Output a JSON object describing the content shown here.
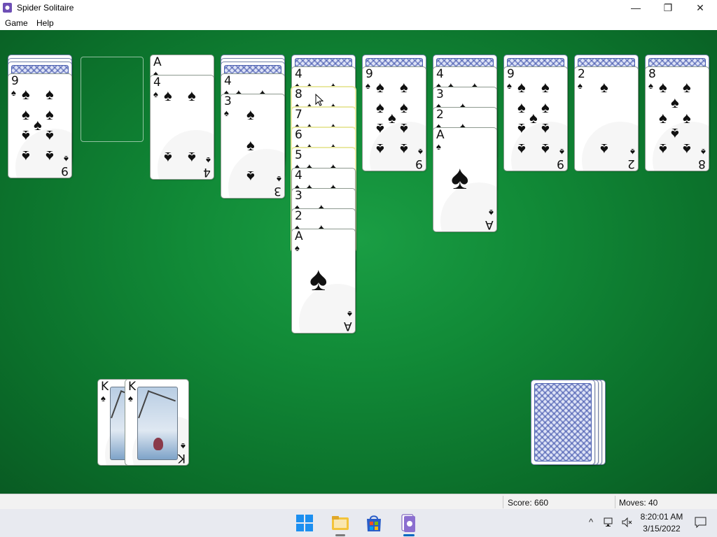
{
  "window": {
    "title": "Spider Solitaire",
    "controls": {
      "minimize": "—",
      "maximize": "❐",
      "close": "✕"
    }
  },
  "menu": {
    "game": "Game",
    "help": "Help"
  },
  "colors": {
    "felt": "#118a37",
    "accent": "#0067c0"
  },
  "suit_symbol": "♠",
  "tableau": [
    {
      "face_down": 3,
      "face_up": [
        "9"
      ]
    },
    {
      "face_down": 0,
      "face_up": []
    },
    {
      "face_down": 0,
      "face_up": [
        "A",
        "4"
      ]
    },
    {
      "face_down": 3,
      "face_up": [
        "4",
        "3"
      ]
    },
    {
      "face_down": 1,
      "face_up": [
        "4",
        "8",
        "7",
        "6",
        "5",
        "4",
        "3",
        "2",
        "A"
      ]
    },
    {
      "face_down": 1,
      "face_up": [
        "9"
      ]
    },
    {
      "face_down": 1,
      "face_up": [
        "4",
        "3",
        "2",
        "A"
      ]
    },
    {
      "face_down": 1,
      "face_up": [
        "9"
      ]
    },
    {
      "face_down": 1,
      "face_up": [
        "2"
      ]
    },
    {
      "face_down": 1,
      "face_up": [
        "8"
      ]
    }
  ],
  "completed_stacks": [
    "K",
    "K"
  ],
  "stock_remaining_piles": 4,
  "status": {
    "score": "Score: 660",
    "moves": "Moves:  40"
  },
  "taskbar": {
    "apps": [
      "start-icon",
      "file-explorer-icon",
      "microsoft-store-icon",
      "spider-solitaire-icon"
    ],
    "tray_chevron": "^",
    "time": "8:20:01 AM",
    "date": "3/15/2022"
  }
}
